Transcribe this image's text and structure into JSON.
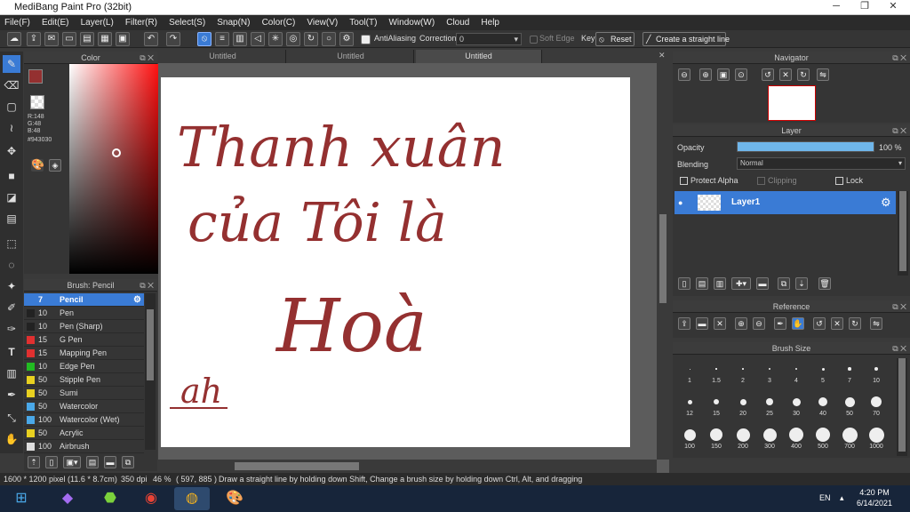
{
  "window": {
    "title": "MediBang Paint Pro (32bit)"
  },
  "menu": [
    "File(F)",
    "Edit(E)",
    "Layer(L)",
    "Filter(R)",
    "Select(S)",
    "Snap(N)",
    "Color(C)",
    "View(V)",
    "Tool(T)",
    "Window(W)",
    "Cloud",
    "Help"
  ],
  "toolbar": {
    "antialiasing_label": "AntiAliasing",
    "correction_label": "Correction",
    "correction_value": "0",
    "soft_edge_label": "Soft Edge",
    "key_label": "Key",
    "reset_label": "Reset",
    "straight_line_label": "Create a straight line"
  },
  "color_panel": {
    "title": "Color",
    "r": "R:148",
    "g": "G:48",
    "b": "B:48",
    "hex": "#943030",
    "fg_color": "#943030"
  },
  "brush_panel": {
    "title": "Brush: Pencil",
    "items": [
      {
        "size": "7",
        "name": "Pencil",
        "color": "#3a7bd5"
      },
      {
        "size": "10",
        "name": "Pen",
        "color": "#222222"
      },
      {
        "size": "10",
        "name": "Pen (Sharp)",
        "color": "#222222"
      },
      {
        "size": "15",
        "name": "G Pen",
        "color": "#e03030"
      },
      {
        "size": "15",
        "name": "Mapping Pen",
        "color": "#e03030"
      },
      {
        "size": "10",
        "name": "Edge Pen",
        "color": "#22bb22"
      },
      {
        "size": "50",
        "name": "Stipple Pen",
        "color": "#e8d020"
      },
      {
        "size": "50",
        "name": "Sumi",
        "color": "#e8d020"
      },
      {
        "size": "50",
        "name": "Watercolor",
        "color": "#4aa8e8"
      },
      {
        "size": "100",
        "name": "Watercolor (Wet)",
        "color": "#4aa8e8"
      },
      {
        "size": "50",
        "name": "Acrylic",
        "color": "#e8d020"
      },
      {
        "size": "100",
        "name": "Airbrush",
        "color": "#dddddd"
      }
    ]
  },
  "tabs": [
    "Untitled",
    "Untitled",
    "Untitled"
  ],
  "canvas_text": {
    "line1": "Thanh xuân",
    "line2": "của Tôi là",
    "line3": "Hoà",
    "signature": "ah",
    "ink_color": "#943030"
  },
  "navigator": {
    "title": "Navigator"
  },
  "layer_panel": {
    "title": "Layer",
    "opacity_label": "Opacity",
    "opacity_value": "100 %",
    "opacity_fraction": 1.0,
    "blending_label": "Blending",
    "blending_value": "Normal",
    "protect_alpha_label": "Protect Alpha",
    "clipping_label": "Clipping",
    "lock_label": "Lock",
    "layer_name": "Layer1"
  },
  "reference": {
    "title": "Reference"
  },
  "brush_size": {
    "title": "Brush Size",
    "sizes": [
      "1",
      "1.5",
      "2",
      "3",
      "4",
      "5",
      "7",
      "10",
      "12",
      "15",
      "20",
      "25",
      "30",
      "40",
      "50",
      "70",
      "100",
      "150",
      "200",
      "300",
      "400",
      "500",
      "700",
      "1000"
    ]
  },
  "statusbar": {
    "dimensions": "1600 * 1200 pixel",
    "physical": "(11.6 * 8.7cm)",
    "dpi": "350 dpi",
    "zoom": "46 %",
    "coords": "( 597, 885 )",
    "hint": "Draw a straight line by holding down Shift, Change a brush size by holding down Ctrl, Alt, and dragging"
  },
  "taskbar": {
    "lang": "EN",
    "time": "4:20 PM",
    "date": "6/14/2021"
  }
}
